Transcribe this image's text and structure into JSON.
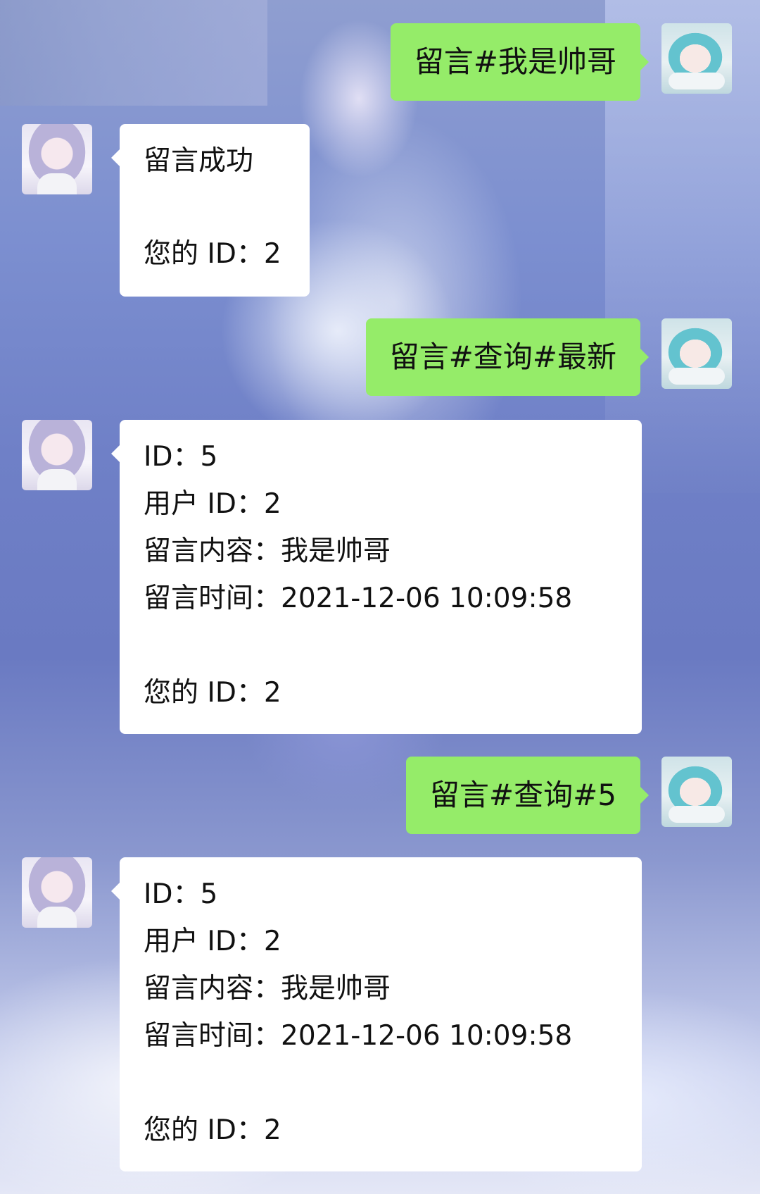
{
  "chat": {
    "messages": [
      {
        "sender": "user",
        "text": "留言#我是帅哥"
      },
      {
        "sender": "bot",
        "lines": [
          "留言成功",
          "",
          "您的 ID：2"
        ]
      },
      {
        "sender": "user",
        "text": "留言#查询#最新"
      },
      {
        "sender": "bot",
        "lines": [
          "ID：5",
          "用户 ID：2",
          "留言内容：我是帅哥",
          "留言时间：2021-12-06 10:09:58",
          "",
          "您的 ID：2"
        ]
      },
      {
        "sender": "user",
        "text": "留言#查询#5"
      },
      {
        "sender": "bot",
        "lines": [
          "ID：5",
          "用户 ID：2",
          "留言内容：我是帅哥",
          "留言时间：2021-12-06 10:09:58",
          "",
          "您的 ID：2"
        ]
      }
    ]
  },
  "colors": {
    "outgoing_bubble": "#95ec69",
    "incoming_bubble": "#ffffff"
  }
}
